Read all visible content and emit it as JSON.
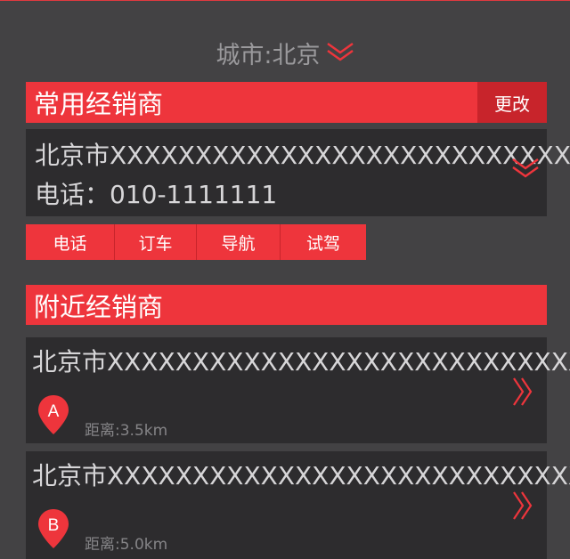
{
  "city": {
    "label": "城市:北京"
  },
  "favorite": {
    "title": "常用经销商",
    "change_label": "更改",
    "address": "北京市XXXXXXXXXXXXXXXXXXXXXXXXXXXX",
    "phone": "电话：010-1111111",
    "actions": [
      {
        "label": "电话"
      },
      {
        "label": "订车"
      },
      {
        "label": "导航"
      },
      {
        "label": "试驾"
      }
    ]
  },
  "nearby": {
    "title": "附近经销商",
    "dealers": [
      {
        "marker": "A",
        "address": "北京市XXXXXXXXXXXXXXXXXXXXXXXXXXXX",
        "distance": "距离:3.5km"
      },
      {
        "marker": "B",
        "address": "北京市XXXXXXXXXXXXXXXXXXXXXXXXXXXX",
        "distance": "距离:5.0km"
      }
    ]
  },
  "colors": {
    "accent": "#ee353c",
    "accent_dark": "#c8242b",
    "background": "#434244",
    "card": "#2d2c2e"
  },
  "icons": {
    "city_dropdown": "double-chevron-down-icon",
    "favorite_expand": "double-chevron-down-icon",
    "dealer_open": "double-chevron-right-icon",
    "map_pin": "map-pin-icon"
  }
}
